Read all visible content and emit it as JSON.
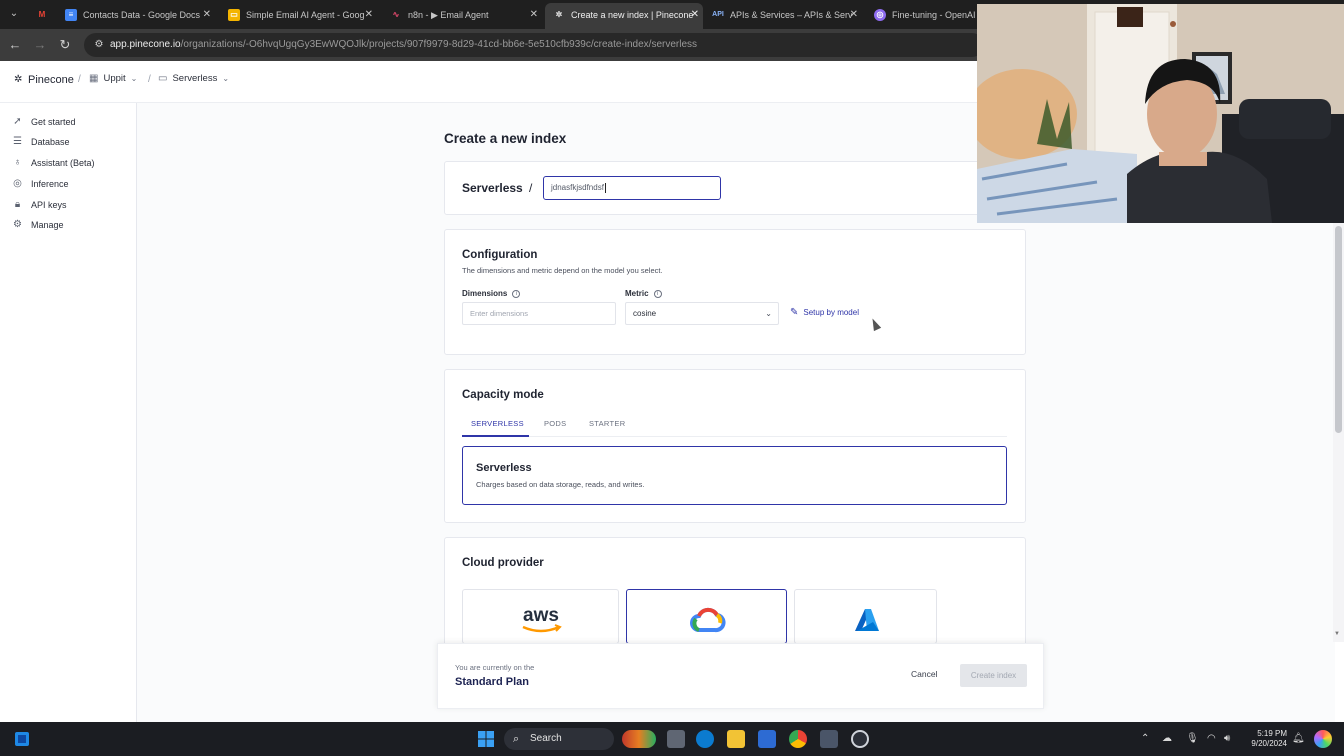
{
  "browser": {
    "tabs": [
      {
        "title": "",
        "favicon": "gmail-icon"
      },
      {
        "title": "Contacts Data - Google Docs",
        "favicon": "google-docs-icon"
      },
      {
        "title": "Simple Email AI Agent - Goog",
        "favicon": "google-slides-icon"
      },
      {
        "title": "n8n - ▶ Email Agent",
        "favicon": "n8n-icon"
      },
      {
        "title": "Create a new index | Pinecone",
        "favicon": "pinecone-icon",
        "active": true
      },
      {
        "title": "APIs & Services – APIs & Serv",
        "favicon": "api-icon"
      },
      {
        "title": "Fine-tuning - OpenAI A",
        "favicon": "openai-icon"
      }
    ],
    "url_host": "app.pinecone.io",
    "url_path": "/organizations/-O6hvqUgqGy3EwWQOJlk/projects/907f9979-8d29-41cd-bb6e-5e510cfb939c/create-index/serverless"
  },
  "header": {
    "brand": "Pinecone",
    "org": "Uppit",
    "project": "Serverless"
  },
  "sidebar": {
    "items": [
      {
        "label": "Get started",
        "icon": "rocket-icon"
      },
      {
        "label": "Database",
        "icon": "database-icon"
      },
      {
        "label": "Assistant (Beta)",
        "icon": "lightbulb-icon"
      },
      {
        "label": "Inference",
        "icon": "inference-icon"
      },
      {
        "label": "API keys",
        "icon": "lock-icon"
      },
      {
        "label": "Manage",
        "icon": "gear-icon"
      }
    ]
  },
  "page": {
    "title": "Create a new index",
    "name_prefix": "Serverless",
    "name_separator": "/",
    "name_value": "jdnasfkjsdfndsf"
  },
  "configuration": {
    "title": "Configuration",
    "subtitle": "The dimensions and metric depend on the model you select.",
    "dimensions_label": "Dimensions",
    "dimensions_placeholder": "Enter dimensions",
    "metric_label": "Metric",
    "metric_value": "cosine",
    "setup_link": "Setup by model"
  },
  "capacity": {
    "title": "Capacity mode",
    "tabs": [
      "SERVERLESS",
      "PODS",
      "STARTER"
    ],
    "selected_title": "Serverless",
    "selected_desc": "Charges based on data storage, reads, and writes."
  },
  "cloud": {
    "title": "Cloud provider",
    "providers": [
      "aws",
      "gcp",
      "azure"
    ],
    "aws_label": "aws"
  },
  "footer": {
    "note": "You are currently on the",
    "plan": "Standard Plan",
    "cancel": "Cancel",
    "create": "Create index"
  },
  "taskbar": {
    "search": "Search",
    "time": "5:19 PM",
    "date": "9/20/2024"
  },
  "colors": {
    "accent": "#2f35a8",
    "chrome_dark": "#1f1f1f",
    "taskbar": "#1b1d22"
  }
}
